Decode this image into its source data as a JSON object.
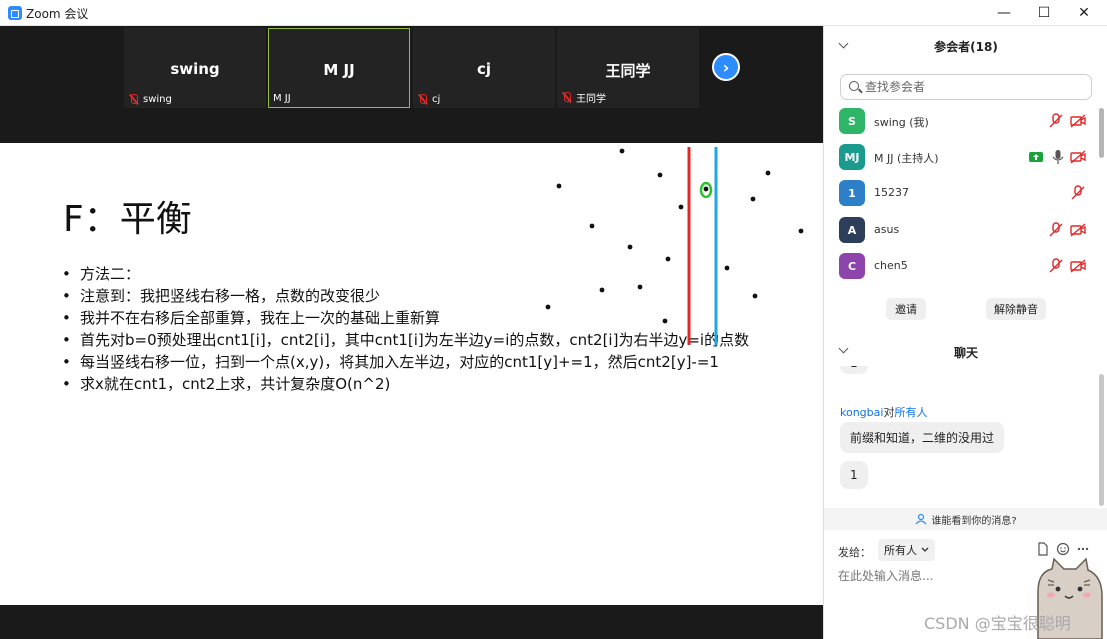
{
  "window": {
    "title": "Zoom 会议",
    "minimize": "—",
    "maximize": "☐",
    "close": "✕"
  },
  "tiles": [
    {
      "name": "swing",
      "footer": "swing"
    },
    {
      "name": "M JJ",
      "footer": "M JJ"
    },
    {
      "name": "cj",
      "footer": "cj"
    },
    {
      "name": "王同学",
      "footer": "王同学"
    }
  ],
  "next_label": "›",
  "slide": {
    "title": "F：平衡",
    "bullets": [
      "方法二：",
      "注意到：我把竖线右移一格，点数的改变很少",
      "我并不在右移后全部重算，我在上一次的基础上重新算",
      "首先对b=0预处理出cnt1[i]，cnt2[i]，其中cnt1[i]为左半边y=i的点数，cnt2[i]为右半边y=i的点数",
      "每当竖线右移一位，扫到一个点(x,y)，将其加入左半边，对应的cnt1[y]+=1，然后cnt2[y]-=1",
      "求x就在cnt1，cnt2上求，共计复杂度O(n^2)"
    ],
    "line_colors": {
      "left": "#e02828",
      "right": "#1ea7e4"
    },
    "highlight_color": "#2ec02e"
  },
  "panel": {
    "participants_title": "参会者(18)",
    "search_placeholder": "查找参会者",
    "participants": [
      {
        "initials": "S",
        "name": "swing (我)",
        "color": "#2fb567"
      },
      {
        "initials": "MJ",
        "name": "M JJ (主持人)",
        "color": "#1a9b8e"
      },
      {
        "initials": "1",
        "name": "15237",
        "color": "#2d7fc8"
      },
      {
        "initials": "A",
        "name": "asus",
        "color": "#2c3e5a"
      },
      {
        "initials": "C",
        "name": "chen5",
        "color": "#8e44ad"
      }
    ],
    "invite_label": "邀请",
    "unmute_label": "解除静音",
    "chat_title": "聊天",
    "chat_prev_bubble": "1",
    "chat_sender": "kongbai",
    "chat_to_word": "对",
    "chat_recipient": "所有人",
    "chat_messages": [
      "前缀和知道，二维的没用过",
      "1"
    ],
    "who_sees": "谁能看到你的消息?",
    "send_to_label": "发给：",
    "send_to_value": "所有人",
    "input_placeholder": "在此处输入消息..."
  },
  "watermark": "CSDN @宝宝很聪明"
}
